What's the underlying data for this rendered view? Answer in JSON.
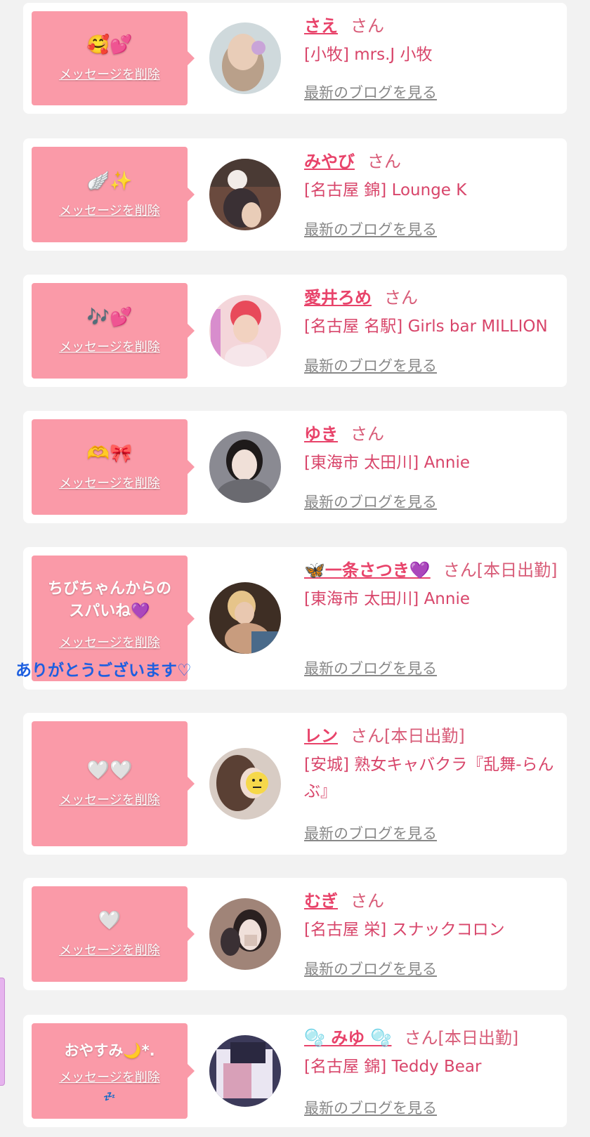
{
  "delete_label": "メッセージを削除",
  "blog_label": "最新のブログを見る",
  "overlay_caption": "ありがとうございます♡",
  "cards": [
    {
      "message": "🥰💕",
      "name": "さえ",
      "suffix": "さん",
      "shop": "[小牧] mrs.J 小牧",
      "avatar_color": "#b9a08a"
    },
    {
      "message": "🪽✨",
      "name": "みやび",
      "suffix": "さん",
      "shop": "[名古屋 錦] Lounge K",
      "avatar_color": "#6a4a3e"
    },
    {
      "message": "🎶💕",
      "name": "愛井ろめ",
      "suffix": "さん",
      "shop": "[名古屋 名駅] Girls bar MILLION",
      "avatar_color": "#e8a0b0"
    },
    {
      "message": "🫶🎀",
      "name": "ゆき",
      "suffix": "さん",
      "shop": "[東海市 太田川] Annie",
      "avatar_color": "#888890"
    },
    {
      "message": "ちびちゃんからの\nスパいね💜",
      "name": "🦋一条さつき💜",
      "suffix": "さん[本日出勤]",
      "shop": "[東海市 太田川] Annie",
      "avatar_color": "#5a4638"
    },
    {
      "message": "🤍🤍",
      "name": "レン",
      "suffix": "さん[本日出勤]",
      "shop": "[安城] 熟女キャバクラ『乱舞-らんぶ』",
      "avatar_color": "#c6b6aa"
    },
    {
      "message": "🤍",
      "name": "むぎ",
      "suffix": "さん",
      "shop": "[名古屋 栄] スナックコロン",
      "avatar_color": "#8a6a5a"
    },
    {
      "message": "おやすみ🌙*.",
      "name": "🫧 みゆ 🫧",
      "suffix": "さん[本日出勤]",
      "shop": "[名古屋 錦] Teddy Bear",
      "avatar_color": "#3c3a5a",
      "small_note": "💤"
    }
  ]
}
